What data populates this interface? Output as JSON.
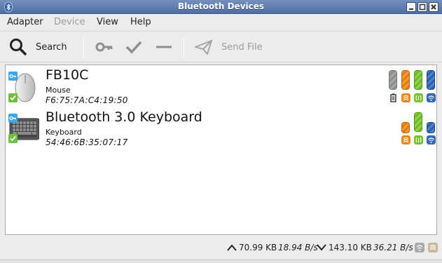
{
  "window": {
    "title": "Bluetooth Devices"
  },
  "menu": {
    "adapter": "Adapter",
    "device": "Device",
    "view": "View",
    "help": "Help"
  },
  "toolbar": {
    "search_label": "Search",
    "send_file_label": "Send File"
  },
  "devices": [
    {
      "name": "FB10C",
      "type": "Mouse",
      "address": "F6:75:7A:C4:19:50",
      "icon": "mouse-icon",
      "trusted": true,
      "paired": true
    },
    {
      "name": "Bluetooth 3.0 Keyboard",
      "type": "Keyboard",
      "address": "54:46:6B:35:07:17",
      "icon": "keyboard-icon",
      "trusted": true,
      "paired": true
    }
  ],
  "status": {
    "upload_total": "70.99 KB",
    "upload_rate": "18.94 B/s",
    "download_total": "143.10 KB",
    "download_rate": "36.21 B/s"
  },
  "colors": {
    "titlebar": "#5a78ab",
    "battery_grey": "#999999",
    "rssi_orange": "#e8861c",
    "lq_green": "#78c22f",
    "tpl_blue": "#3468b4"
  }
}
